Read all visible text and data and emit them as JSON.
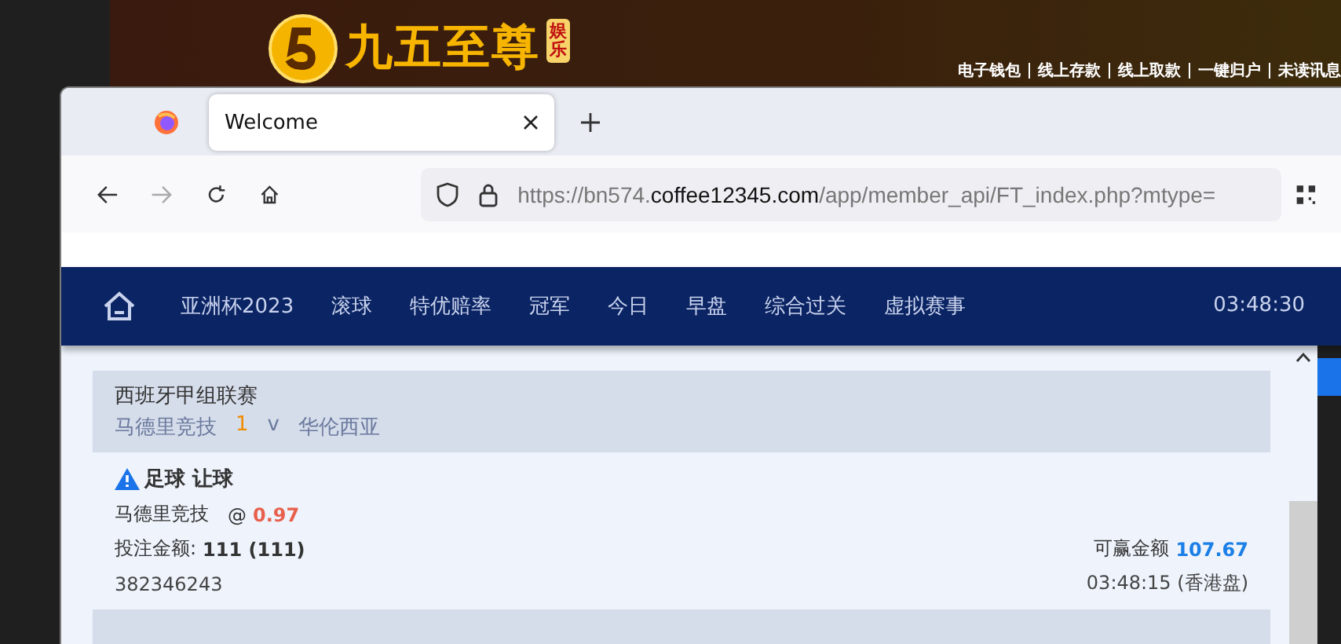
{
  "banner": {
    "logo_text": "九五至尊",
    "badge_text": "娱乐",
    "links": [
      "电子钱包",
      "线上存款",
      "线上取款",
      "一键归户",
      "未读讯息"
    ]
  },
  "browser": {
    "tabs": [
      {
        "label": "Welcome",
        "selected": true
      }
    ],
    "url": {
      "prefix": "https://bn574.",
      "domain": "coffee12345.com",
      "path": "/app/member_api/FT_index.php?mtype="
    }
  },
  "nav": {
    "items": [
      "亚洲杯2023",
      "滚球",
      "特优赔率",
      "冠军",
      "今日",
      "早盘",
      "综合过关",
      "虚拟赛事"
    ],
    "clock": "03:48:30"
  },
  "bets": [
    {
      "league": "西班牙甲组联赛",
      "home": "马德里竞技",
      "score": "1",
      "vs": "v",
      "away": "华伦西亚",
      "title": "足球 让球",
      "pick": "马德里竞技",
      "at": "@",
      "odds": "0.97",
      "stake_label": "投注金额:",
      "stake": "111 (111)",
      "win_label": "可赢金额",
      "win": "107.67",
      "ticket": "382346243",
      "time": "03:48:15 (香港盘)"
    }
  ]
}
